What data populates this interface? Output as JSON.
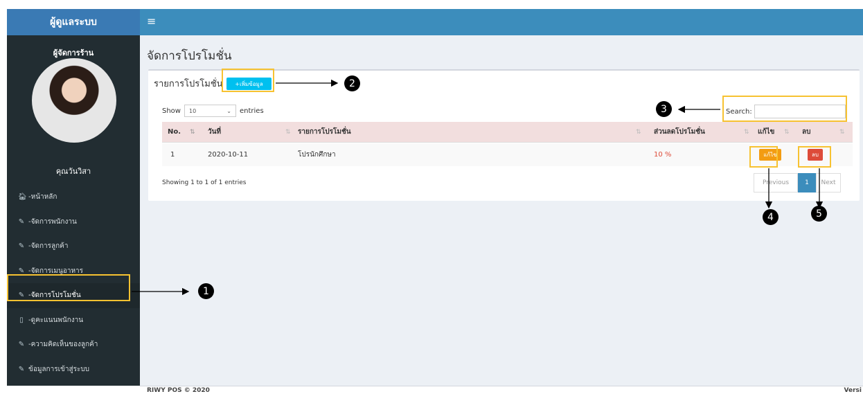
{
  "brand": "ผู้ดูแลระบบ",
  "topbar": {
    "menu_icon": "≡"
  },
  "sidebar": {
    "role": "ผู้จัดการร้าน",
    "user_name": "คุณวันวิสา",
    "items": [
      {
        "icon": "home-icon",
        "glyph": "🏠︎",
        "label": "-หน้าหลัก"
      },
      {
        "icon": "edit-icon",
        "glyph": "✎",
        "label": "-จัดการพนักงาน"
      },
      {
        "icon": "edit-icon",
        "glyph": "✎",
        "label": "-จัดการลูกค้า"
      },
      {
        "icon": "edit-icon",
        "glyph": "✎",
        "label": "-จัดการเมนูอาหาร"
      },
      {
        "icon": "edit-icon",
        "glyph": "✎",
        "label": "-จัดการโปรโมชั่น"
      },
      {
        "icon": "square-icon",
        "glyph": "▯",
        "label": "-ดูคะแนนพนักงาน"
      },
      {
        "icon": "edit-icon",
        "glyph": "✎",
        "label": "-ความคิดเห็นของลูกค้า"
      },
      {
        "icon": "edit-icon",
        "glyph": "✎",
        "label": "ข้อมูลการเข้าสู่ระบบ"
      }
    ]
  },
  "main": {
    "page_title": "จัดการโปรโมชั่น",
    "box_title": "รายการโปรโมชั่น",
    "add_button": "+เพิ่มข้อมูล",
    "show_label": "Show",
    "entries_value": "10",
    "entries_label": "entries",
    "search_label": "Search:",
    "search_value": "",
    "columns": [
      "No.",
      "วันที่",
      "รายการโปรโมชั่น",
      "ส่วนลดโปรโมชั่น",
      "แก้ไข",
      "ลบ"
    ],
    "rows": [
      {
        "no": "1",
        "date": "2020-10-11",
        "name": "โปรนักศึกษา",
        "discount": "10 %",
        "edit": "แก้ไข",
        "delete": "ลบ"
      }
    ],
    "info": "Showing 1 to 1 of 1 entries",
    "pager": {
      "prev": "Previous",
      "current": "1",
      "next": "Next"
    }
  },
  "footer": {
    "left": "RIWY POS © 2020",
    "right": "Versi"
  },
  "annotations": [
    "1",
    "2",
    "3",
    "4",
    "5"
  ],
  "colors": {
    "highlight": "#f7c231",
    "topbar": "#3c8dbc",
    "sidebar": "#222d32"
  }
}
